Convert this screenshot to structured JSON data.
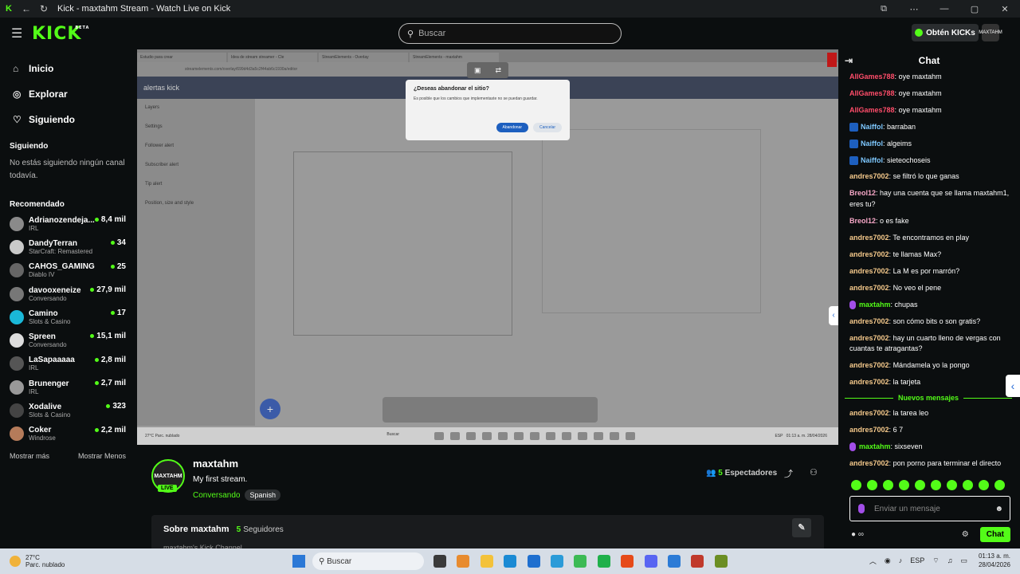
{
  "window": {
    "title": "Kick - maxtahm Stream - Watch Live on Kick"
  },
  "header": {
    "logo": "KICK",
    "beta": "BETA",
    "search_placeholder": "Buscar",
    "kicks_label": "Obtén KICKs",
    "avatar_text": "MAXTAHM"
  },
  "sidebar": {
    "nav": [
      {
        "label": "Inicio",
        "icon": "home-icon"
      },
      {
        "label": "Explorar",
        "icon": "compass-icon"
      },
      {
        "label": "Siguiendo",
        "icon": "heart-icon"
      }
    ],
    "following_title": "Siguiendo",
    "following_empty": "No estás siguiendo ningún canal todavía.",
    "recommended_title": "Recomendado",
    "recommended": [
      {
        "name": "Adrianozendeja...",
        "category": "IRL",
        "viewers": "8,4 mil"
      },
      {
        "name": "DandyTerran",
        "category": "StarCraft: Remastered",
        "viewers": "34"
      },
      {
        "name": "CAHOS_GAMING",
        "category": "Diablo IV",
        "viewers": "25"
      },
      {
        "name": "davooxeneize",
        "category": "Conversando",
        "viewers": "27,9 mil"
      },
      {
        "name": "Camino",
        "category": "Slots & Casino",
        "viewers": "17"
      },
      {
        "name": "Spreen",
        "category": "Conversando",
        "viewers": "15,1 mil"
      },
      {
        "name": "LaSapaaaaa",
        "category": "IRL",
        "viewers": "2,8 mil"
      },
      {
        "name": "Brunenger",
        "category": "IRL",
        "viewers": "2,7 mil"
      },
      {
        "name": "Xodalive",
        "category": "Slots & Casino",
        "viewers": "323"
      },
      {
        "name": "Coker",
        "category": "Windrose",
        "viewers": "2,2 mil"
      }
    ],
    "show_more": "Mostrar más",
    "show_less": "Mostrar Menos"
  },
  "video": {
    "tabs": [
      "Estudio para crear",
      "Idea de stream streamer - Cle",
      "StreamElements - Overlay",
      "StreamElements - maxtahm"
    ],
    "url": "streamelements.com/overlay/699d4d3a5c2f44ab6c1930a/editor",
    "page_title": "alertas kick",
    "side_items": [
      "Layers",
      "Settings",
      "Follower alert",
      "Subscriber alert",
      "Tip alert",
      "Position, size and style"
    ],
    "dialog": {
      "title": "¿Deseas abandonar el sitio?",
      "body": "Es posible que los cambios que implementaste no se puedan guardar.",
      "leave": "Abandonar",
      "cancel": "Cancelar"
    },
    "taskbar": {
      "temp": "27°C",
      "weather": "Parc. nublado",
      "search": "Buscar",
      "lang": "ESP",
      "time": "01:13 a. m.",
      "date": "28/04/2026"
    }
  },
  "stream": {
    "streamer": "maxtahm",
    "avatar_text": "MAXTAHM",
    "live": "LIVE",
    "title": "My first stream.",
    "category": "Conversando",
    "language": "Spanish",
    "viewers_count": "5",
    "viewers_label": "Espectadores",
    "about_title": "Sobre maxtahm",
    "followers_count": "5",
    "followers_label": "Seguidores",
    "about_sub": "maxtahm's Kick Channel"
  },
  "chat": {
    "title": "Chat",
    "messages": [
      {
        "user": "AllGames788",
        "text": "oye maxtahm",
        "color": "#ff4d6a",
        "badge": ""
      },
      {
        "user": "AllGames788",
        "text": "oye maxtahm",
        "color": "#ff4d6a",
        "badge": ""
      },
      {
        "user": "AllGames788",
        "text": "oye maxtahm",
        "color": "#ff4d6a",
        "badge": ""
      },
      {
        "user": "Naiffol",
        "text": "barraban",
        "color": "#7ec8ff",
        "badge": "blue"
      },
      {
        "user": "Naiffol",
        "text": "algeims",
        "color": "#7ec8ff",
        "badge": "blue"
      },
      {
        "user": "Naiffol",
        "text": "sieteochoseis",
        "color": "#7ec8ff",
        "badge": "blue"
      },
      {
        "user": "andres7002",
        "text": "se filtró lo que ganas",
        "color": "#f5c98b",
        "badge": ""
      },
      {
        "user": "Breol12",
        "text": "hay una cuenta que se llama maxtahm1, eres tu?",
        "color": "#f7a8c8",
        "badge": ""
      },
      {
        "user": "Breol12",
        "text": "o es fake",
        "color": "#f7a8c8",
        "badge": ""
      },
      {
        "user": "andres7002",
        "text": "Te encontramos en play",
        "color": "#f5c98b",
        "badge": ""
      },
      {
        "user": "andres7002",
        "text": "te llamas Max?",
        "color": "#f5c98b",
        "badge": ""
      },
      {
        "user": "andres7002",
        "text": "La M es por marrón?",
        "color": "#f5c98b",
        "badge": ""
      },
      {
        "user": "andres7002",
        "text": "No veo el pene",
        "color": "#f5c98b",
        "badge": ""
      },
      {
        "user": "maxtahm",
        "text": "chupas",
        "color": "#53fc18",
        "badge": "mic"
      },
      {
        "user": "andres7002",
        "text": "son cómo bits o son gratis?",
        "color": "#f5c98b",
        "badge": ""
      },
      {
        "user": "andres7002",
        "text": "hay un cuarto lleno de vergas con cuantas te atragantas?",
        "color": "#f5c98b",
        "badge": ""
      },
      {
        "user": "andres7002",
        "text": "Mándamela yo la pongo",
        "color": "#f5c98b",
        "badge": ""
      },
      {
        "user": "andres7002",
        "text": "la tarjeta",
        "color": "#f5c98b",
        "badge": ""
      }
    ],
    "new_messages": "Nuevos mensajes",
    "messages_after": [
      {
        "user": "andres7002",
        "text": "la tarea leo",
        "color": "#f5c98b",
        "badge": ""
      },
      {
        "user": "andres7002",
        "text": "6 7",
        "color": "#f5c98b",
        "badge": ""
      },
      {
        "user": "maxtahm",
        "text": "sixseven",
        "color": "#53fc18",
        "badge": "mic"
      },
      {
        "user": "andres7002",
        "text": "pon porno para terminar el directo",
        "color": "#f5c98b",
        "badge": ""
      }
    ],
    "input_placeholder": "Enviar un mensaje",
    "send_label": "Chat"
  },
  "taskbar": {
    "temp": "27°C",
    "weather": "Parc. nublado",
    "search": "Buscar",
    "lang": "ESP",
    "time": "01:13 a. m.",
    "date": "28/04/2026"
  }
}
